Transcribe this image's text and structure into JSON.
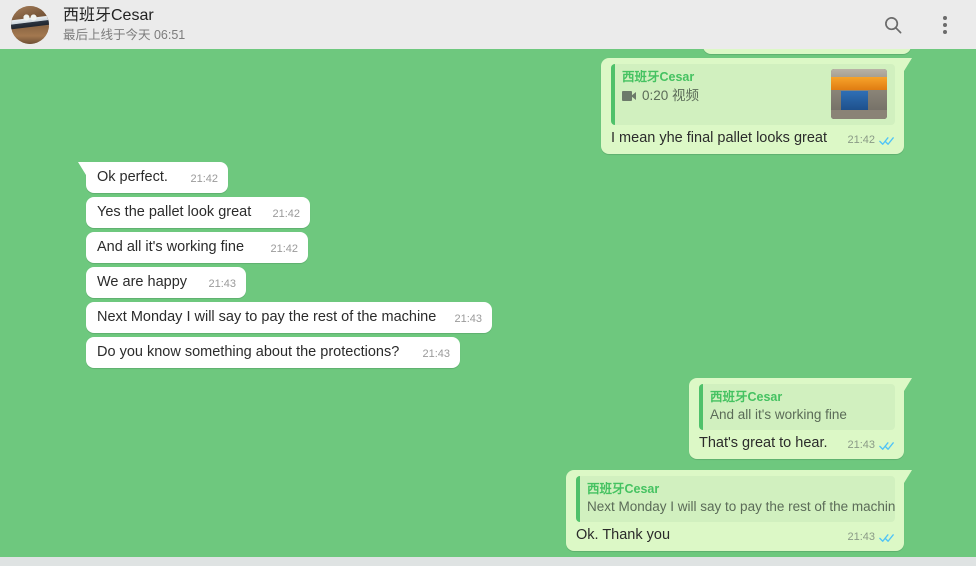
{
  "header": {
    "contact_name": "西班牙Cesar",
    "status": "最后上线于今天 06:51",
    "search_icon": "search-icon",
    "menu_icon": "overflow-menu-icon"
  },
  "colors": {
    "chat_background": "#6ec87e",
    "header_background": "#ebebeb",
    "incoming_bubble": "#ffffff",
    "outgoing_bubble": "#dcf8c6",
    "quote_background": "#d1f0bf",
    "quote_accent": "#4fc16a",
    "quote_name": "#45c261",
    "read_tick": "#4fc3f7"
  },
  "messages": [
    {
      "id": "m1",
      "direction": "outgoing",
      "quote": {
        "sender": "西班牙Cesar",
        "media_label": "0:20 视频",
        "media_icon": "video-camera-icon",
        "has_thumbnail": true
      },
      "text": "I mean yhe final pallet looks great",
      "time": "21:42",
      "status": "read"
    },
    {
      "id": "m2",
      "direction": "incoming",
      "text": "Ok perfect.",
      "time": "21:42"
    },
    {
      "id": "m3",
      "direction": "incoming",
      "text": "Yes the pallet look great",
      "time": "21:42"
    },
    {
      "id": "m4",
      "direction": "incoming",
      "text": "And all it's working fine",
      "time": "21:42"
    },
    {
      "id": "m5",
      "direction": "incoming",
      "text": "We are happy",
      "time": "21:43"
    },
    {
      "id": "m6",
      "direction": "incoming",
      "text": "Next Monday I will say to pay the rest of the machine",
      "time": "21:43"
    },
    {
      "id": "m7",
      "direction": "incoming",
      "text": "Do you know something about the protections?",
      "time": "21:43"
    },
    {
      "id": "m8",
      "direction": "outgoing",
      "quote": {
        "sender": "西班牙Cesar",
        "body": "And all it's working fine",
        "has_thumbnail": false
      },
      "text": "That's great to hear.",
      "time": "21:43",
      "status": "read"
    },
    {
      "id": "m9",
      "direction": "outgoing",
      "quote": {
        "sender": "西班牙Cesar",
        "body": "Next Monday I will say to pay the rest of the machine",
        "has_thumbnail": false
      },
      "text": "Ok. Thank you",
      "time": "21:43",
      "status": "read"
    }
  ]
}
